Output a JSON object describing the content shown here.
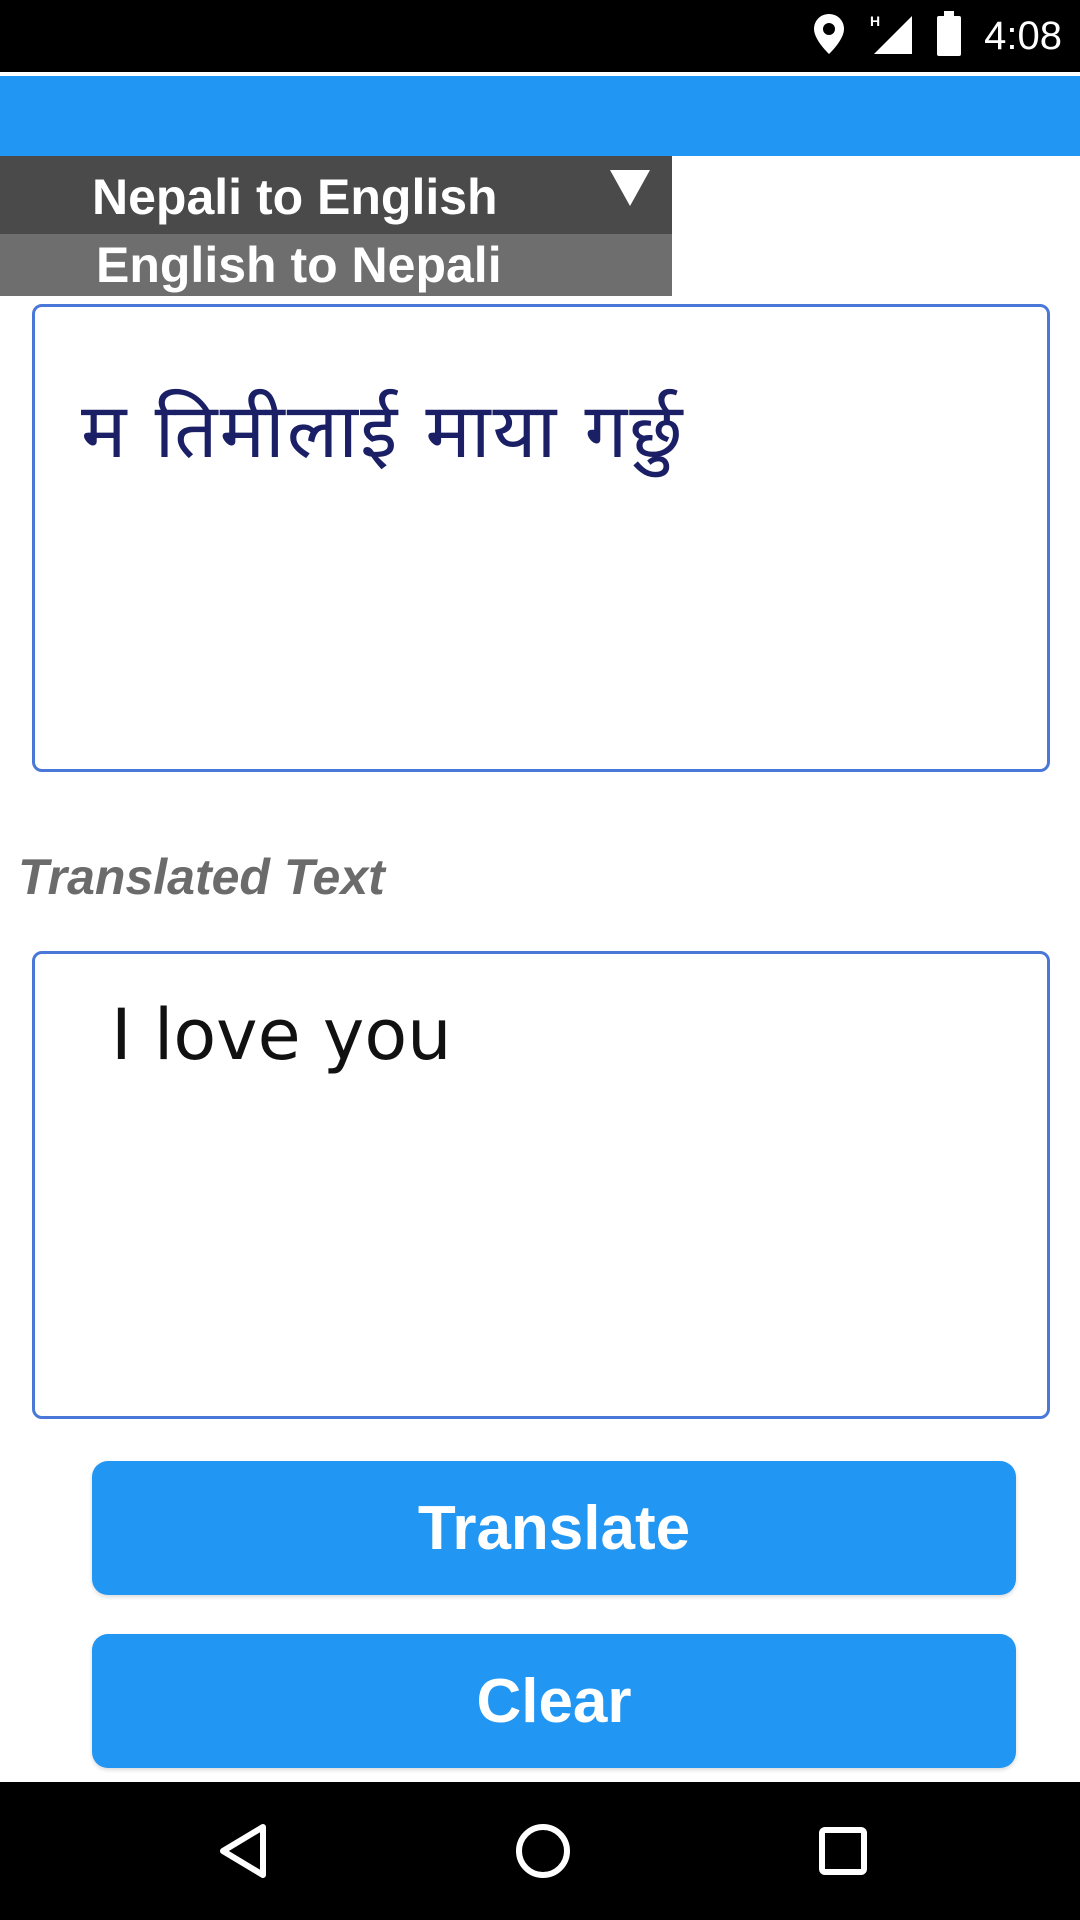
{
  "status_bar": {
    "time": "4:08",
    "icons": [
      "location-icon",
      "signal-h-icon",
      "battery-icon"
    ]
  },
  "app_bar": {
    "color": "#2196F3"
  },
  "language_dropdown": {
    "selected": "Nepali to English",
    "options": [
      "English to Nepali"
    ]
  },
  "source": {
    "text": "म तिमीलाई माया गर्छु"
  },
  "translated_label": "Translated Text",
  "result": {
    "text": "I love you"
  },
  "buttons": {
    "translate": "Translate",
    "clear": "Clear"
  },
  "nav_bar": {
    "icons": [
      "back-icon",
      "home-icon",
      "recent-apps-icon"
    ]
  },
  "colors": {
    "accent": "#2196F3",
    "dropdown_selected": "#4a4a4a",
    "dropdown_option": "#6e6e6e",
    "textbox_border": "#4a78d8"
  }
}
